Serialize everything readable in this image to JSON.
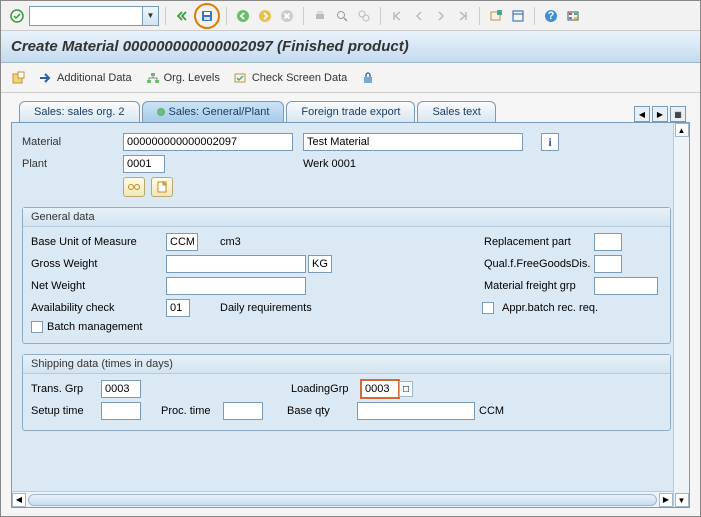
{
  "title": "Create Material 000000000000002097 (Finished product)",
  "appbar": {
    "additional": "Additional Data",
    "orglevels": "Org. Levels",
    "checkscreen": "Check Screen Data"
  },
  "tabs": {
    "t1": "Sales: sales org. 2",
    "t2": "Sales: General/Plant",
    "t3": "Foreign trade export",
    "t4": "Sales text"
  },
  "header": {
    "material_label": "Material",
    "material_value": "000000000000002097",
    "material_desc": "Test Material",
    "plant_label": "Plant",
    "plant_value": "0001",
    "plant_name": "Werk 0001"
  },
  "general": {
    "title": "General data",
    "buom_label": "Base Unit of Measure",
    "buom_value": "CCM",
    "buom_text": "cm3",
    "gross_label": "Gross Weight",
    "gross_unit": "KG",
    "net_label": "Net Weight",
    "avail_label": "Availability check",
    "avail_value": "01",
    "avail_text": "Daily requirements",
    "batch_label": "Batch management",
    "repl_label": "Replacement part",
    "qual_label": "Qual.f.FreeGoodsDis.",
    "mfg_label": "Material freight grp",
    "abr_label": "Appr.batch rec. req."
  },
  "shipping": {
    "title": "Shipping data (times in days)",
    "trans_label": "Trans. Grp",
    "trans_value": "0003",
    "loading_label": "LoadingGrp",
    "loading_value": "0003",
    "setup_label": "Setup time",
    "proc_label": "Proc. time",
    "base_label": "Base qty",
    "base_unit": "CCM"
  }
}
